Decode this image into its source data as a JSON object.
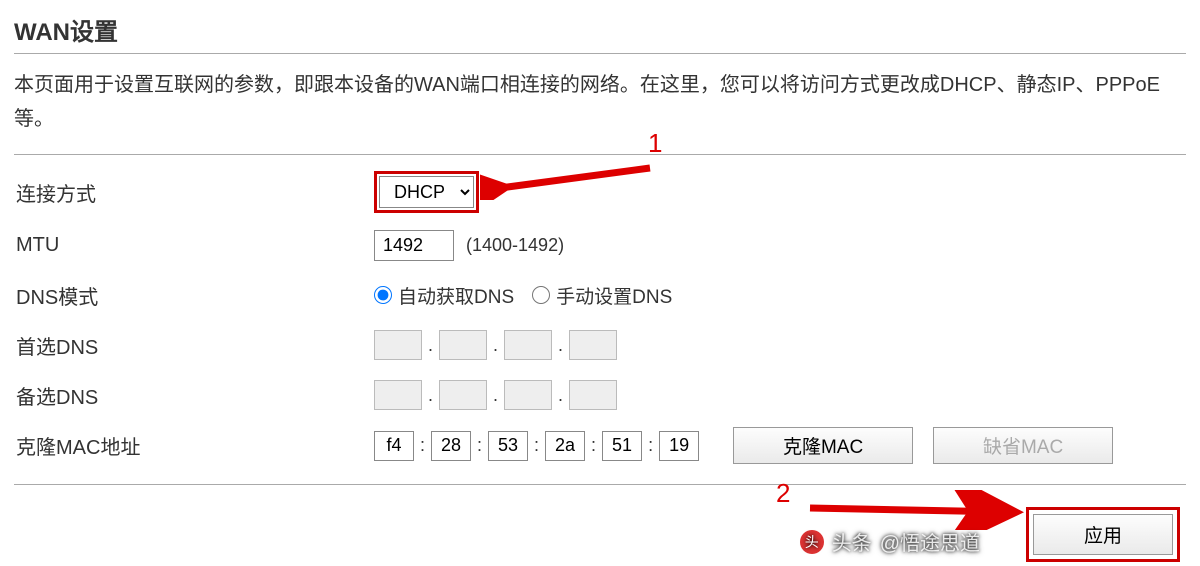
{
  "header": {
    "title": "WAN设置",
    "description": "本页面用于设置互联网的参数，即跟本设备的WAN端口相连接的网络。在这里，您可以将访问方式更改成DHCP、静态IP、PPPoE等。"
  },
  "form": {
    "connection": {
      "label": "连接方式",
      "value": "DHCP"
    },
    "mtu": {
      "label": "MTU",
      "value": "1492",
      "hint": "(1400-1492)"
    },
    "dns_mode": {
      "label": "DNS模式",
      "options": {
        "auto": "自动获取DNS",
        "manual": "手动设置DNS"
      },
      "selected": "auto"
    },
    "primary_dns": {
      "label": "首选DNS"
    },
    "secondary_dns": {
      "label": "备选DNS"
    },
    "clone_mac": {
      "label": "克隆MAC地址",
      "values": [
        "f4",
        "28",
        "53",
        "2a",
        "51",
        "19"
      ],
      "buttons": {
        "clone": "克隆MAC",
        "default": "缺省MAC"
      }
    }
  },
  "actions": {
    "apply": "应用"
  },
  "annotations": {
    "marker1": "1",
    "marker2": "2"
  },
  "watermark": {
    "prefix": "头条",
    "author": "@悟途思道"
  }
}
